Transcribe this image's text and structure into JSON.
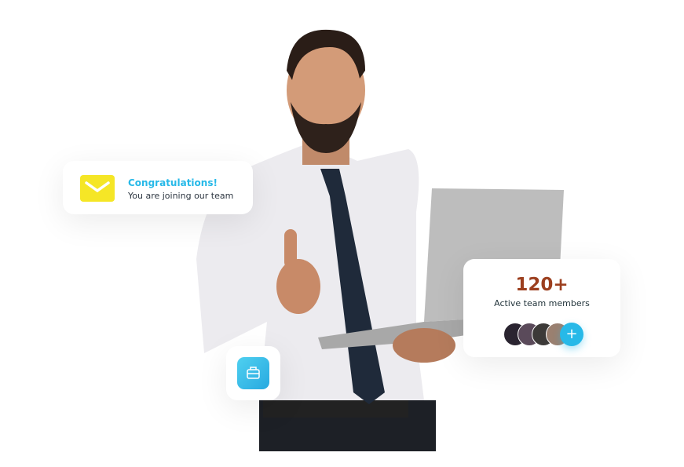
{
  "notification": {
    "title": "Congratulations!",
    "subtitle": "You are joining our team",
    "icon": "envelope-icon"
  },
  "team": {
    "count": "120+",
    "label": "Active team members",
    "add_icon": "+"
  },
  "badge": {
    "icon": "briefcase-icon"
  },
  "colors": {
    "accent": "#27b9e8",
    "count": "#9c3f1f",
    "mail": "#f5e626"
  }
}
